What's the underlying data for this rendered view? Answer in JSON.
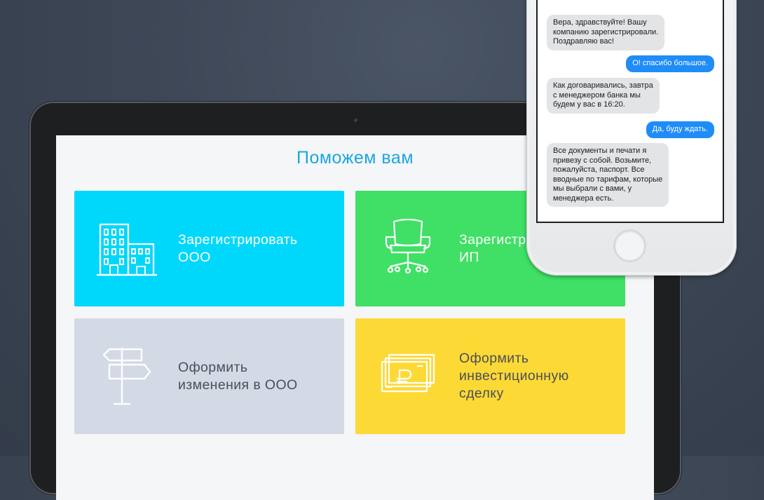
{
  "tablet": {
    "screen_title": "Поможем вам",
    "tiles": [
      {
        "label": "Зарегистрировать\nООО",
        "icon": "office-building-icon",
        "color": "#00d8fb"
      },
      {
        "label": "Зарегистрировать\nИП",
        "icon": "office-chair-icon",
        "color": "#3fe065"
      },
      {
        "label": "Оформить\nизменения в ООО",
        "icon": "signpost-icon",
        "color": "#d3d9e5"
      },
      {
        "label": "Оформить\nинвестиционную\nсделку",
        "icon": "ruble-banknotes-icon",
        "color": "#fdd935"
      }
    ]
  },
  "phone": {
    "messages": [
      {
        "direction": "incoming",
        "text": "Вера, здравствуйте! Вашу\nкомпанию зарегистрировали.\nПоздравляю вас!"
      },
      {
        "direction": "outgoing",
        "text": "О! спасибо большое."
      },
      {
        "direction": "incoming",
        "text": "Как договаривались, завтра\nс менеджером банка мы\nбудем у вас в 16:20."
      },
      {
        "direction": "outgoing",
        "text": "Да, буду ждать."
      },
      {
        "direction": "incoming",
        "text": "Все документы и печати я\nпривезу с собой. Возьмите,\nпожалуйста, паспорт. Все\nвводные по тарифам, которые\nмы выбрали с вами, у\nменеджера есть."
      }
    ],
    "incoming_color": "#e3e4e6",
    "outgoing_color": "#1f8cf7"
  }
}
